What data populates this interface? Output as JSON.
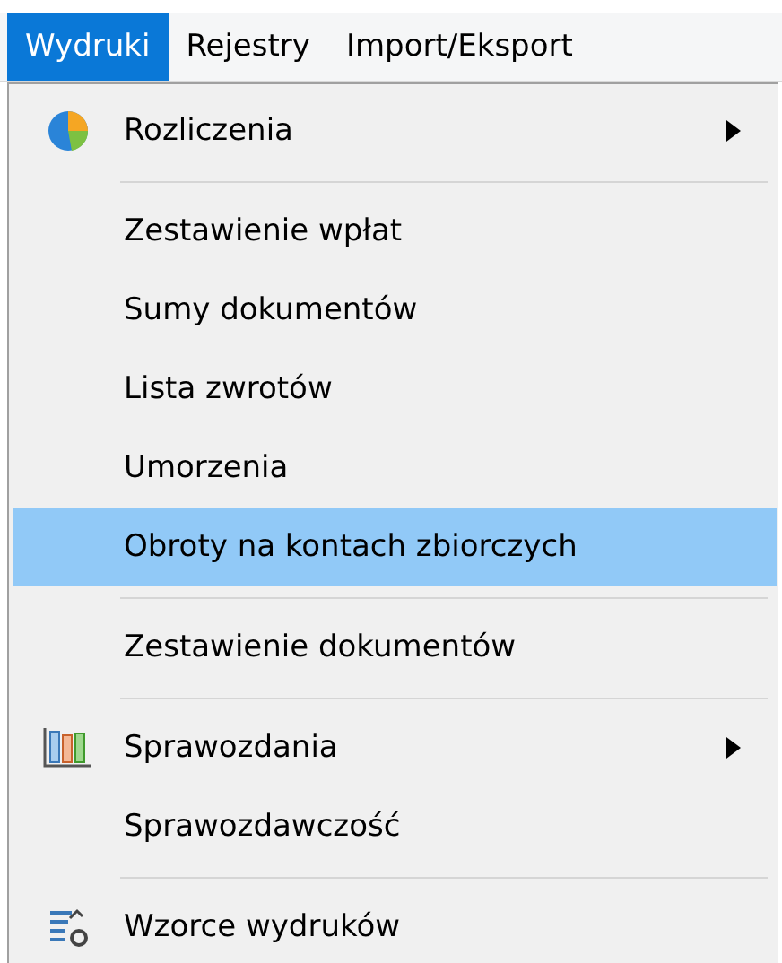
{
  "menubar": [
    {
      "label": "Wydruki",
      "selected": true
    },
    {
      "label": "Rejestry",
      "selected": false
    },
    {
      "label": "Import/Eksport",
      "selected": false
    }
  ],
  "menu": [
    {
      "kind": "item",
      "label": "Rozliczenia",
      "submenu": true,
      "selected": false
    },
    {
      "kind": "separator"
    },
    {
      "kind": "item",
      "label": "Zestawienie wpłat",
      "submenu": false,
      "selected": false
    },
    {
      "kind": "item",
      "label": "Sumy dokumentów",
      "submenu": false,
      "selected": false
    },
    {
      "kind": "item",
      "label": "Lista zwrotów",
      "submenu": false,
      "selected": false
    },
    {
      "kind": "item",
      "label": "Umorzenia",
      "submenu": false,
      "selected": false
    },
    {
      "kind": "item",
      "label": "Obroty na kontach zbiorczych",
      "submenu": false,
      "selected": true
    },
    {
      "kind": "separator"
    },
    {
      "kind": "item",
      "label": "Zestawienie dokumentów",
      "submenu": false,
      "selected": false
    },
    {
      "kind": "separator"
    },
    {
      "kind": "item",
      "label": "Sprawozdania",
      "submenu": true,
      "selected": false
    },
    {
      "kind": "item",
      "label": "Sprawozdawczość",
      "submenu": false,
      "selected": false
    },
    {
      "kind": "separator"
    },
    {
      "kind": "item",
      "label": "Wzorce wydruków",
      "submenu": false,
      "selected": false
    }
  ]
}
